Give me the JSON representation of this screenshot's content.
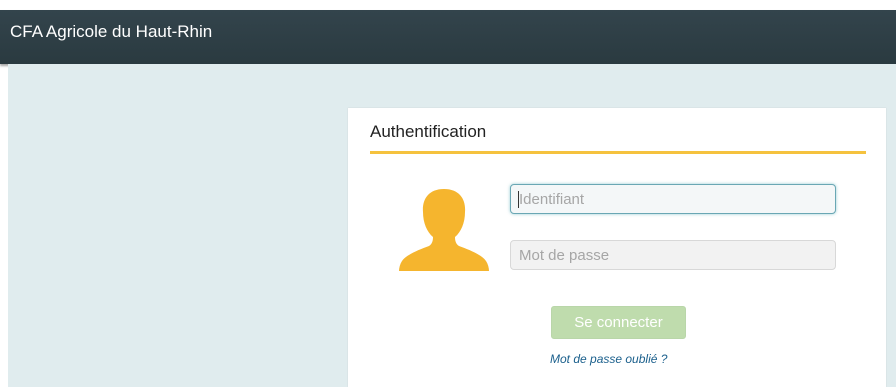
{
  "header": {
    "title": "CFA Agricole du Haut-Rhin"
  },
  "auth": {
    "title": "Authentification",
    "login_placeholder": "Identifiant",
    "login_value": "",
    "password_placeholder": "Mot de passe",
    "password_value": "",
    "submit_label": "Se connecter",
    "forgot_label": "Mot de passe oublié ?",
    "avatar_icon": "user-silhouette-icon"
  },
  "colors": {
    "header_bg": "#2f3f46",
    "page_bg": "#e0ecee",
    "accent": "#f5c23e",
    "button_bg": "#bfdcad",
    "link": "#1a5f8c"
  }
}
